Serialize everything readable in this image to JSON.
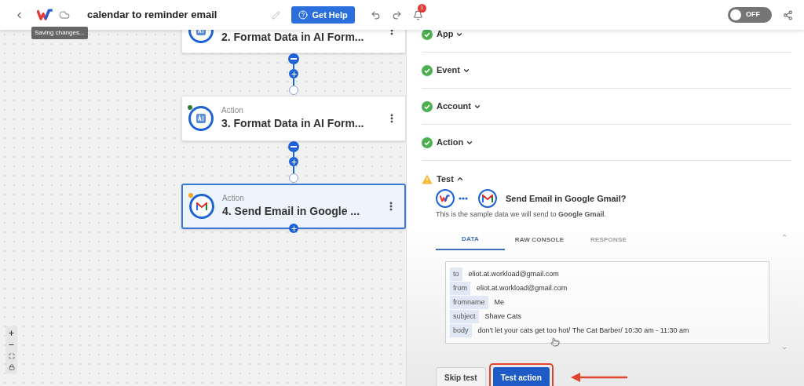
{
  "header": {
    "title": "calendar to reminder email",
    "help_button": "Get Help",
    "notification_count": "1",
    "tooltip": "Saving changes...",
    "toggle": {
      "label": "OFF",
      "on": false
    }
  },
  "canvas": {
    "steps": [
      {
        "title": "2. Format Data in AI Form...",
        "kind": "ai",
        "selected": false
      },
      {
        "label": "Action",
        "title": "3. Format Data in AI Form...",
        "kind": "ai",
        "selected": false,
        "color": "#2e7d32"
      },
      {
        "label": "Action",
        "title": "4. Send Email in Google ...",
        "kind": "gmail",
        "selected": true,
        "color": "#f5a623"
      }
    ]
  },
  "panel": {
    "sections": [
      {
        "label": "App",
        "kind": "done",
        "expanded": false
      },
      {
        "label": "Event",
        "kind": "done",
        "expanded": false
      },
      {
        "label": "Account",
        "kind": "done",
        "expanded": false
      },
      {
        "label": "Action",
        "kind": "done",
        "expanded": false
      },
      {
        "label": "Test",
        "kind": "warning",
        "expanded": true
      }
    ],
    "test": {
      "title": "Send Email in Google Gmail?",
      "intro": "This is the sample data we will send to **Google Gmail**.",
      "tabs": [
        {
          "label": "DATA",
          "selected": true,
          "disabled": false
        },
        {
          "label": "RAW CONSOLE",
          "selected": false,
          "disabled": false
        },
        {
          "label": "RESPONSE",
          "selected": false,
          "disabled": true
        }
      ],
      "fields": [
        {
          "key": "to",
          "value": "eliot.at.workload@gmail.com"
        },
        {
          "key": "from",
          "value": "eliot.at.workload@gmail.com"
        },
        {
          "key": "fromname",
          "value": "Me"
        },
        {
          "key": "subject",
          "value": "Shave Cats"
        },
        {
          "key": "body",
          "value": "don't let your cats get too hot/ The Cat Barber/ 10:30 am - 11:30 am"
        }
      ],
      "buttons": [
        {
          "label": "Skip test",
          "kind": "secondary",
          "highlighted": false
        },
        {
          "label": "Test action",
          "kind": "primary",
          "highlighted": true
        }
      ]
    }
  }
}
